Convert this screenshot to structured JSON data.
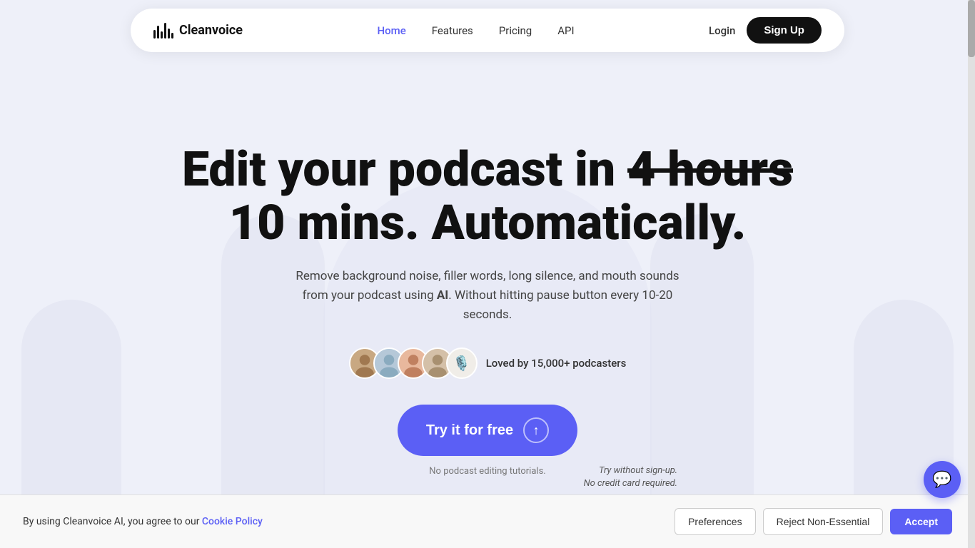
{
  "nav": {
    "logo_text": "Cleanvoice",
    "links": [
      {
        "label": "Home",
        "active": true
      },
      {
        "label": "Features",
        "active": false
      },
      {
        "label": "Pricing",
        "active": false
      },
      {
        "label": "API",
        "active": false
      }
    ],
    "login_label": "Login",
    "signup_label": "Sign Up"
  },
  "hero": {
    "title_part1": "Edit your podcast in ",
    "title_strikethrough": "4 hours",
    "title_part2": "10 mins. Automatically.",
    "subtitle": "Remove background noise, filler words, long silence, and mouth sounds from your podcast using AI. Without hitting pause button every 10-20 seconds.",
    "subtitle_bold": "AI",
    "social_proof": "Loved by 15,000+ podcasters",
    "cta_label": "Try it for free",
    "cta_note": "No podcast editing tutorials.",
    "annotation_line1": "Try without sign-up.",
    "annotation_line2": "No credit card required."
  },
  "cookie": {
    "text": "By using Cleanvoice AI, you agree to our ",
    "link_text": "Cookie Policy",
    "preferences_label": "Preferences",
    "reject_label": "Reject Non-Essential",
    "accept_label": "Accept"
  },
  "colors": {
    "accent": "#5b5ff5",
    "dark": "#111111",
    "bg": "#eef0f9"
  }
}
